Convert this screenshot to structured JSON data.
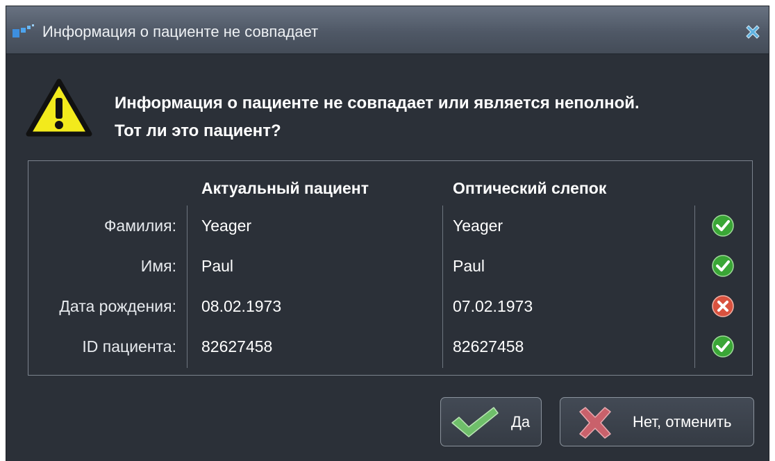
{
  "dialog": {
    "title": "Информация о пациенте не совпадает",
    "message_line1": "Информация о пациенте не совпадает или является неполной.",
    "message_line2": "Тот ли это пациент?"
  },
  "table": {
    "columns": [
      "Актуальный пациент",
      "Оптический слепок"
    ],
    "rows": [
      {
        "label": "Фамилия:",
        "current": "Yeager",
        "scan": "Yeager",
        "match": true
      },
      {
        "label": "Имя:",
        "current": "Paul",
        "scan": "Paul",
        "match": true
      },
      {
        "label": "Дата рождения:",
        "current": "08.02.1973",
        "scan": "07.02.1973",
        "match": false
      },
      {
        "label": "ID пациента:",
        "current": "82627458",
        "scan": "82627458",
        "match": true
      }
    ]
  },
  "buttons": {
    "yes": "Да",
    "no": "Нет, отменить"
  },
  "icons": {
    "app": "app-logo-icon",
    "close": "close-icon",
    "warning": "warning-triangle-icon",
    "match": "check-circle-icon",
    "mismatch": "cross-circle-icon",
    "yes": "checkmark-icon",
    "no": "cross-icon"
  },
  "colors": {
    "warning_fill": "#f2ea1c",
    "match_green": "#3aa636",
    "mismatch_red": "#d9523f",
    "close_blue": "#5fb2e0"
  }
}
